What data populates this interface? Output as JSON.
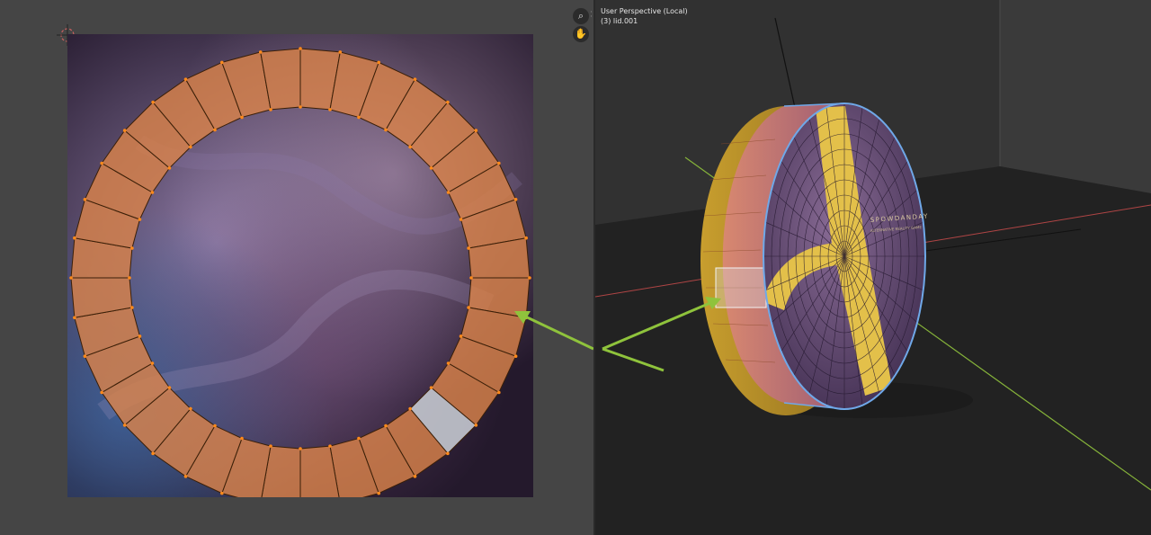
{
  "viewport": {
    "view_name": "User Perspective (Local)",
    "object_info": "(3) lid.001",
    "logo_text": "SPOWDANDAY",
    "logo_subtext": "ALTERNATIVE REALITY GAME"
  },
  "nav_buttons": {
    "zoom_icon": "⌕",
    "pan_icon": "✋"
  },
  "uv_editor": {
    "ring_segments": 36,
    "selected_segment": 13
  },
  "colors": {
    "uv_face": "#d9824a",
    "uv_edge": "#3a1f08",
    "uv_vertex": "#ff8a1a",
    "selected_face": "#c4c8cf",
    "annotation_arrow": "#8fc33c",
    "viewport_bg": "#303030",
    "floor": "#202020",
    "mesh_edge": "#6fa8e8",
    "inlay": "#e3c04a"
  }
}
